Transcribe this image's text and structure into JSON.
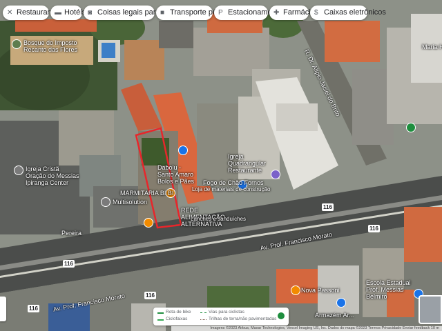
{
  "chips": [
    {
      "icon": "fork-knife-icon",
      "glyph": "✕",
      "label": "Restaurantes"
    },
    {
      "icon": "bed-icon",
      "glyph": "▬",
      "label": "Hotéis"
    },
    {
      "icon": "camera-icon",
      "glyph": "◙",
      "label": "Coisas legais para fazer"
    },
    {
      "icon": "bus-icon",
      "glyph": "■",
      "label": "Transporte público"
    },
    {
      "icon": "parking-icon",
      "glyph": "P",
      "label": "Estacionamento"
    },
    {
      "icon": "pharmacy-icon",
      "glyph": "✚",
      "label": "Farmácias"
    },
    {
      "icon": "atm-icon",
      "glyph": "$",
      "label": "Caixas eletrônicos"
    }
  ],
  "places": {
    "bosque": "Bosque do Imposto Recanto das Flores",
    "igreja": "Igreja Cristã Oração do Messias Ipiranga Center",
    "multisolution": "Multisolution",
    "marmitaria": "MARMITARIA BI BI",
    "dabolu": "Dabolu - Santo Amaro Bolos e Pães",
    "alimentacao": "REDE ALIMENTAÇÃO ALTERNATIVA",
    "alimentacao_sub": "Lanches e sanduíches",
    "fogo": "Fogo de Chão Fornos",
    "fogo_sub": "Loja de materiais de construção",
    "igreja_restaurante": "Igreja Quadrangular Restaurante",
    "pereira": "Pereira",
    "nova_passoni": "Nova Passoni",
    "escola": "Escola Estadual Prof. Messias Belmiro",
    "armazem": "Armazém Ar...",
    "maria_helena": "Maria He..."
  },
  "roads": {
    "main_upper": "Av. Prof. Francisco Morato",
    "main_lower": "Av. Prof. Francisco Morato",
    "side": "R. Dr. Alípio Jaciel do Brito"
  },
  "shields": [
    "116",
    "116",
    "116",
    "116",
    "116"
  ],
  "legend": {
    "bike_route": "Rota de bike",
    "bike_lane": "Ciclofaixas",
    "cycle_paths": "Vias para ciclistas",
    "dirt_trails": "Trilhas de terra/não pavimentadas"
  },
  "attribution": "Imagens ©2023 Airbus, Maxar Technologies, Vexcel Imaging US, Inc. Dados do mapa ©2023  Termos  Privacidade  Enviar feedback  10 m",
  "colors": {
    "highlight": "#e8262b",
    "bike_route": "#1e8e3e",
    "roof_tile": "#d9673e"
  }
}
